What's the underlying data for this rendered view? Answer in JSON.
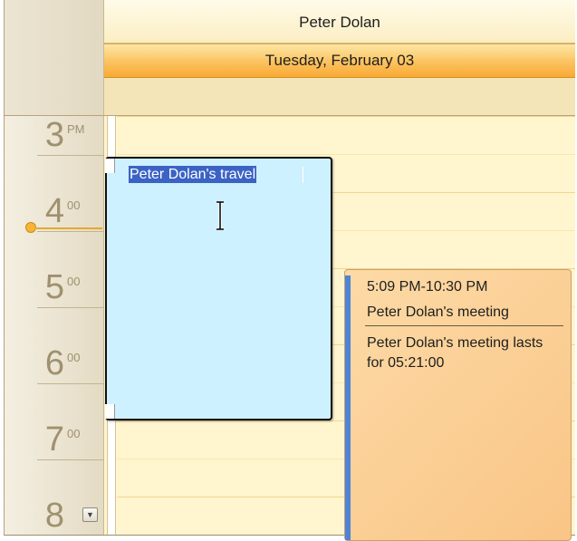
{
  "resource": {
    "name": "Peter Dolan"
  },
  "day": {
    "date_label": "Tuesday, February 03"
  },
  "time_ruler": {
    "hours": [
      {
        "big": "3",
        "small": "PM"
      },
      {
        "big": "4",
        "small": "00"
      },
      {
        "big": "5",
        "small": "00"
      },
      {
        "big": "6",
        "small": "00"
      },
      {
        "big": "7",
        "small": "00"
      },
      {
        "big": "8",
        "small": ""
      }
    ]
  },
  "appointments": {
    "travel": {
      "subject": "Peter Dolan's travel"
    },
    "meeting": {
      "time_range": "5:09 PM-10:30 PM",
      "subject": "Peter Dolan's meeting",
      "description": "Peter Dolan's meeting lasts for 05:21:00",
      "status_color": "#4e84d8",
      "label_color": "#f9c586"
    }
  },
  "icons": {
    "scroll_down": "chevron-down-icon",
    "now_indicator": "current-time-dot"
  },
  "colors": {
    "busy_status": "#c8403b",
    "travel_background": "#cdf1ff",
    "date_header": "#fbc25e"
  }
}
